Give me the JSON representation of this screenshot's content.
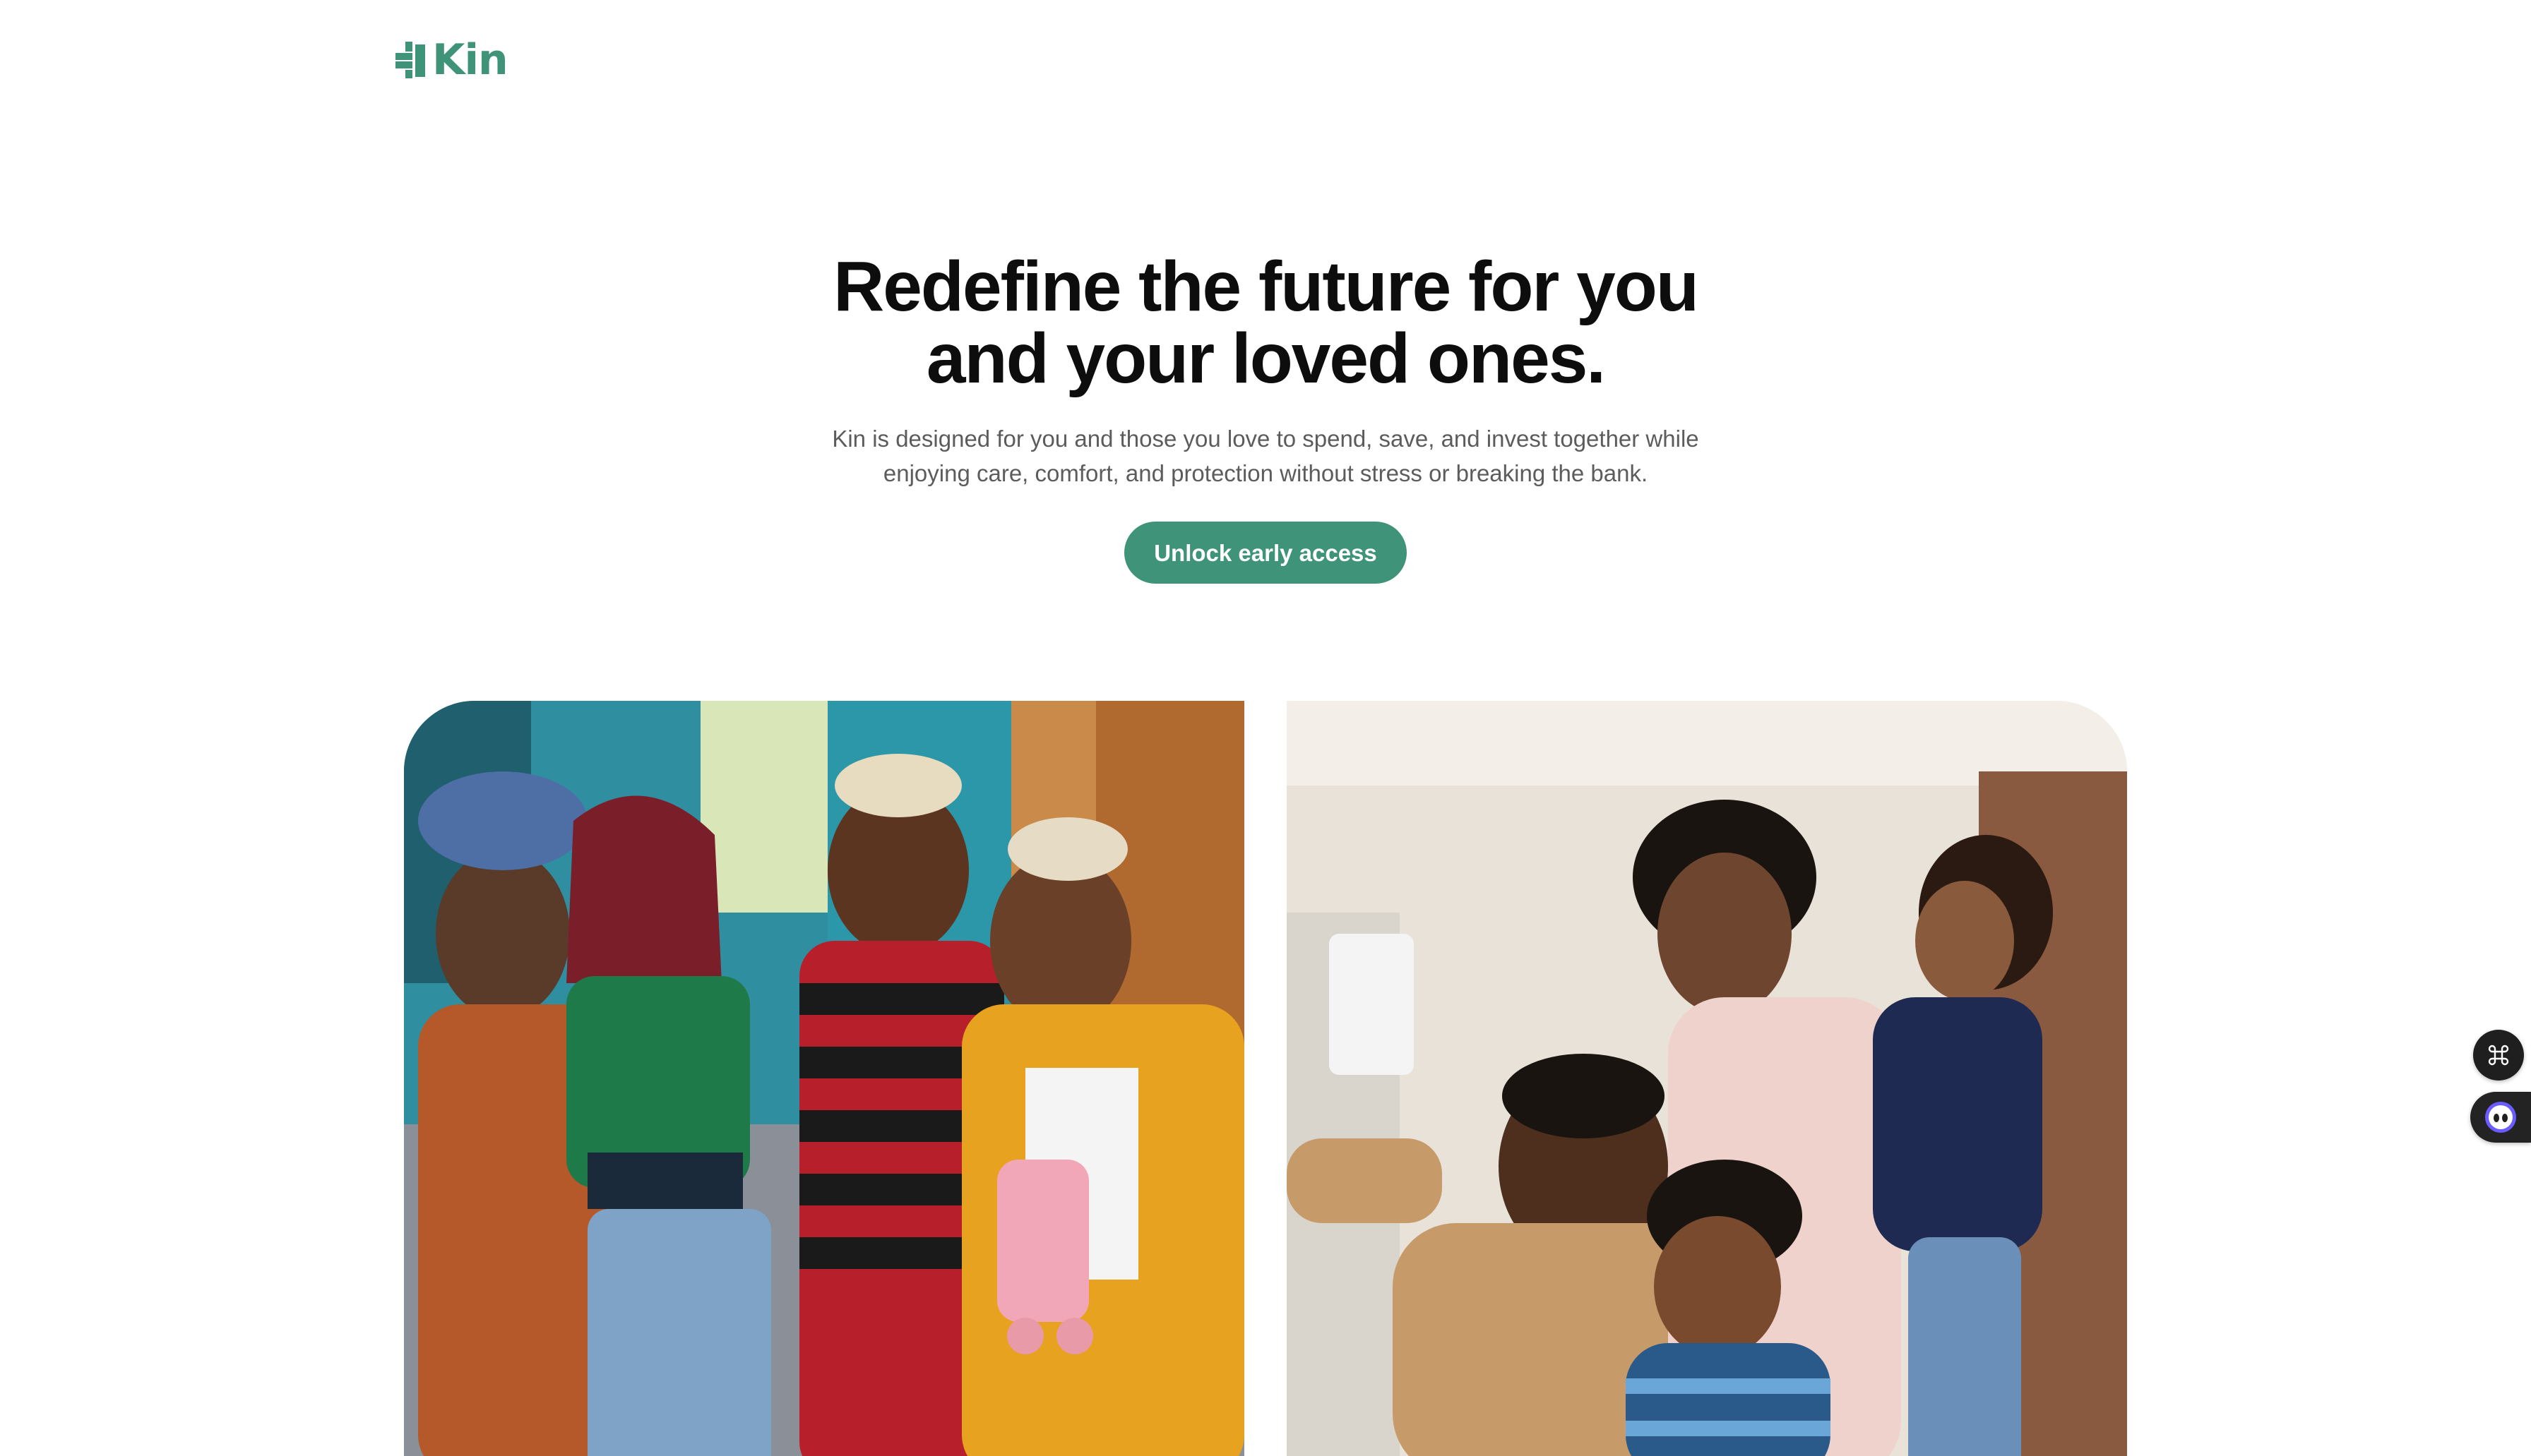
{
  "brand": {
    "name": "Kin",
    "icon": "kin-logo-mark",
    "color": "#3f9378"
  },
  "hero": {
    "headline": "Redefine the future for you and your loved ones.",
    "subtext": "Kin is designed for you and those you love to spend, save, and invest together while enjoying care, comfort, and protection without stress or breaking the bank.",
    "cta_label": "Unlock early access",
    "cta_color": "#3f9378"
  },
  "images": {
    "left": "photo-friends-group",
    "right": "photo-family-selfie"
  },
  "widgets": {
    "command": "command-key-icon",
    "assistant": "chat-bot-icon"
  }
}
